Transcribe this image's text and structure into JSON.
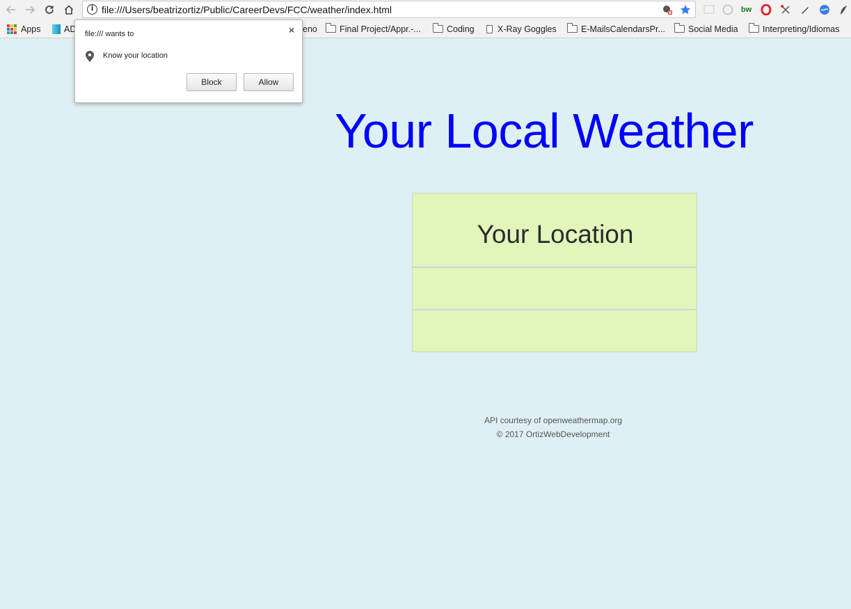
{
  "browser": {
    "url": "file:///Users/beatrizortiz/Public/CareerDevs/FCC/weather/index.html",
    "bookmarks": [
      {
        "label": "Apps",
        "kind": "apps"
      },
      {
        "label": "AD",
        "kind": "favicon"
      },
      {
        "label": "eno",
        "kind": "text"
      },
      {
        "label": "Final Project/Appr.-...",
        "kind": "folder"
      },
      {
        "label": "Coding",
        "kind": "folder"
      },
      {
        "label": "X-Ray Goggles",
        "kind": "page"
      },
      {
        "label": "E-MailsCalendarsPr...",
        "kind": "folder"
      },
      {
        "label": "Social Media",
        "kind": "folder"
      },
      {
        "label": "Interpreting/Idiomas",
        "kind": "folder"
      }
    ]
  },
  "permission_popup": {
    "title": "file:/// wants to",
    "message": "Know your location",
    "close_glyph": "×",
    "block_label": "Block",
    "allow_label": "Allow"
  },
  "page": {
    "title": "Your Local Weather",
    "location_heading": "Your Location",
    "footer_line1": "API courtesy of openweathermap.org",
    "footer_line2": "© 2017 OrtizWebDevelopment"
  },
  "colors": {
    "page_background": "#dff0f4",
    "title_color": "#0000ff",
    "box_background": "#e2f5bb"
  }
}
